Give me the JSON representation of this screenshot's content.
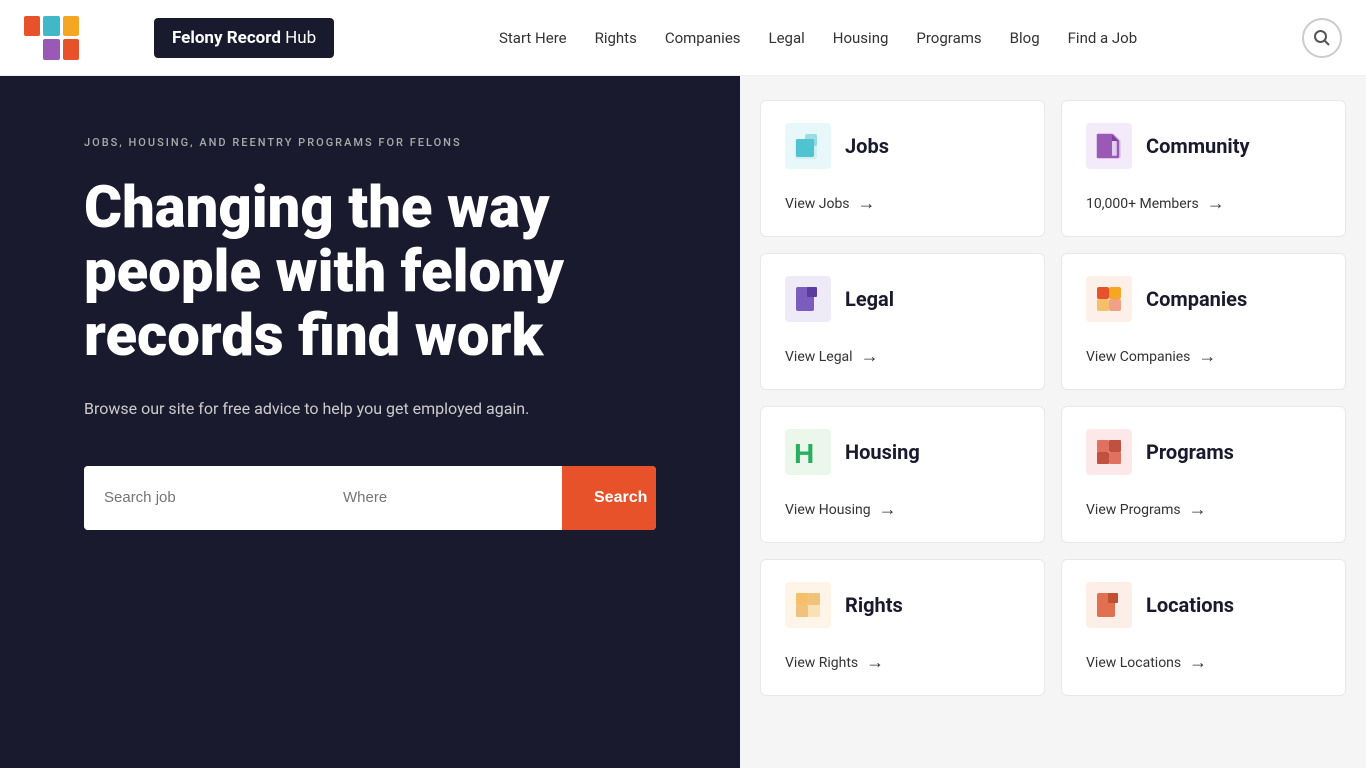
{
  "header": {
    "logo_brand": "Felony Record",
    "logo_suffix": " Hub",
    "nav_items": [
      {
        "label": "Start Here",
        "id": "start-here"
      },
      {
        "label": "Rights",
        "id": "rights"
      },
      {
        "label": "Companies",
        "id": "companies"
      },
      {
        "label": "Legal",
        "id": "legal"
      },
      {
        "label": "Housing",
        "id": "housing"
      },
      {
        "label": "Programs",
        "id": "programs"
      },
      {
        "label": "Blog",
        "id": "blog"
      },
      {
        "label": "Find a Job",
        "id": "find-a-job"
      }
    ]
  },
  "hero": {
    "tag": "JOBS, HOUSING, AND REENTRY PROGRAMS FOR FELONS",
    "title": "Changing the way people with felony records find work",
    "subtitle": "Browse our site for free advice to help you get employed again.",
    "search_job_placeholder": "Search job",
    "search_where_placeholder": "Where",
    "search_button": "Search"
  },
  "cards": [
    {
      "id": "jobs",
      "title": "Jobs",
      "link_label": "View Jobs",
      "icon_class": "icon-jobs",
      "shape_class": "jobs-shape"
    },
    {
      "id": "community",
      "title": "Community",
      "link_label": "10,000+ Members",
      "icon_class": "icon-community",
      "shape_class": "community-shape"
    },
    {
      "id": "legal",
      "title": "Legal",
      "link_label": "View Legal",
      "icon_class": "icon-legal",
      "shape_class": "legal-shape"
    },
    {
      "id": "companies",
      "title": "Companies",
      "link_label": "View Companies",
      "icon_class": "icon-companies",
      "shape_class": "companies-shape"
    },
    {
      "id": "housing",
      "title": "Housing",
      "link_label": "View Housing",
      "icon_class": "icon-housing",
      "shape_class": "housing-shape"
    },
    {
      "id": "programs",
      "title": "Programs",
      "link_label": "View Programs",
      "icon_class": "icon-programs",
      "shape_class": "programs-shape"
    },
    {
      "id": "rights",
      "title": "Rights",
      "link_label": "View Rights",
      "icon_class": "icon-rights",
      "shape_class": "rights-shape"
    },
    {
      "id": "locations",
      "title": "Locations",
      "link_label": "View Locations",
      "icon_class": "icon-locations",
      "shape_class": "locations-shape"
    }
  ]
}
